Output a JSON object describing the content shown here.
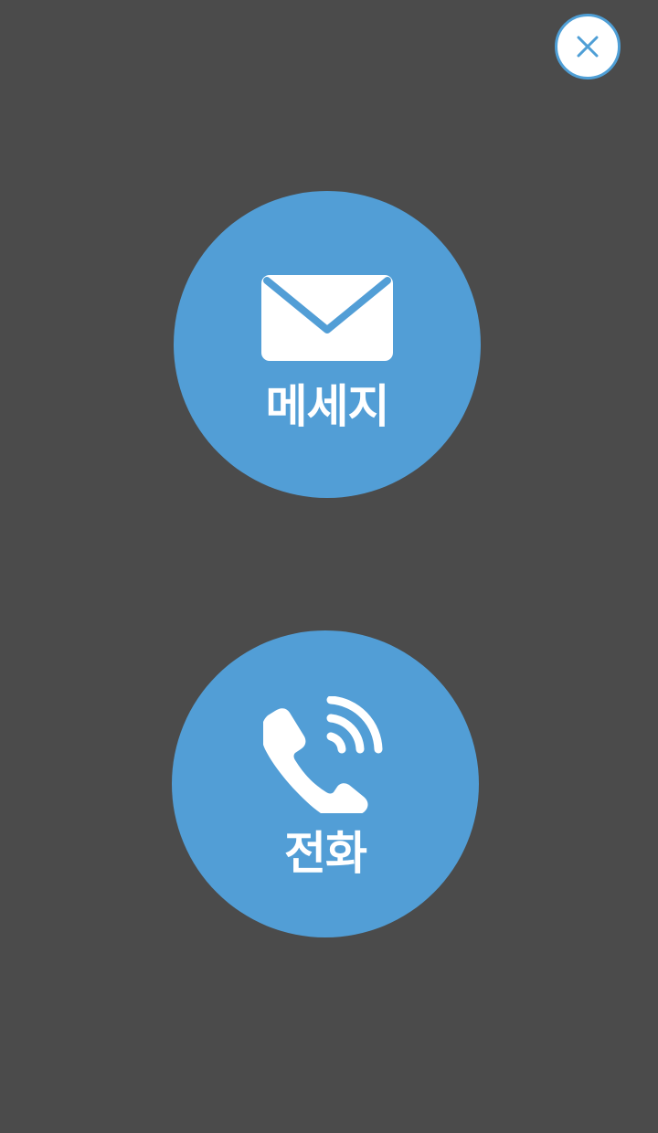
{
  "close_button": {
    "icon": "close-icon",
    "accent": "#4f9fd6"
  },
  "actions": {
    "message": {
      "label": "메세지",
      "icon": "envelope-icon",
      "color": "#529ed6"
    },
    "call": {
      "label": "전화",
      "icon": "phone-call-icon",
      "color": "#529ed6"
    }
  },
  "background": "#4b4b4b"
}
